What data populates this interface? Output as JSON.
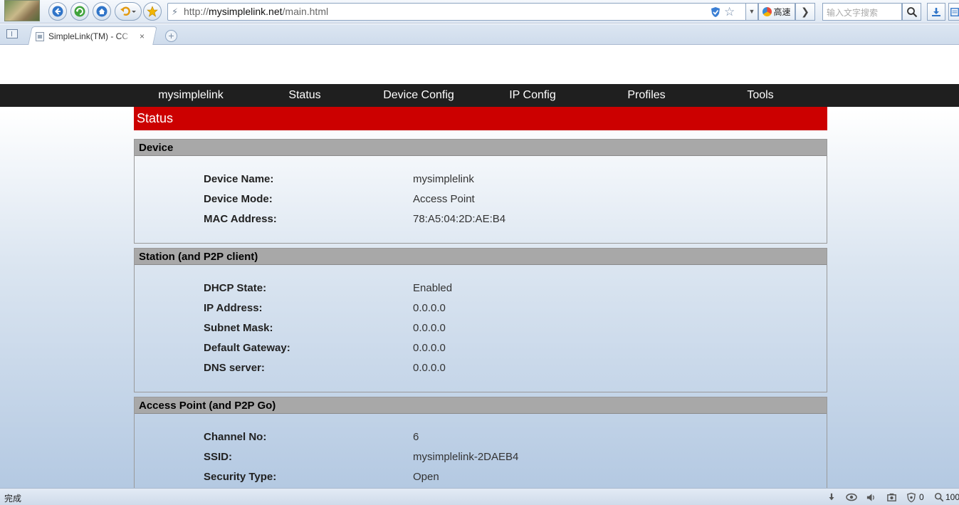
{
  "browser": {
    "url_prefix": "http://",
    "url_domain": "mysimplelink.net",
    "url_path": "/main.html",
    "speed_mode_label": "高速",
    "search_placeholder": "输入文字搜索",
    "tab_title": "SimpleLink(TM) - CC",
    "tab_close": "×",
    "new_tab": "+",
    "status_text": "完成",
    "status_count": "0",
    "zoom": "100"
  },
  "nav": {
    "items": [
      "mysimplelink",
      "Status",
      "Device Config",
      "IP Config",
      "Profiles",
      "Tools"
    ]
  },
  "page": {
    "banner_title": "Status"
  },
  "sections": [
    {
      "title": "Device",
      "rows": [
        {
          "label": "Device Name:",
          "value": "mysimplelink"
        },
        {
          "label": "Device Mode:",
          "value": "Access Point"
        },
        {
          "label": "MAC Address:",
          "value": "78:A5:04:2D:AE:B4"
        }
      ]
    },
    {
      "title": "Station (and P2P client)",
      "rows": [
        {
          "label": "DHCP State:",
          "value": "Enabled"
        },
        {
          "label": "IP Address:",
          "value": "0.0.0.0"
        },
        {
          "label": "Subnet Mask:",
          "value": "0.0.0.0"
        },
        {
          "label": "Default Gateway:",
          "value": "0.0.0.0"
        },
        {
          "label": "DNS server:",
          "value": "0.0.0.0"
        }
      ]
    },
    {
      "title": "Access Point (and P2P Go)",
      "rows": [
        {
          "label": "Channel No:",
          "value": "6"
        },
        {
          "label": "SSID:",
          "value": "mysimplelink-2DAEB4"
        },
        {
          "label": "Security Type:",
          "value": "Open"
        }
      ]
    }
  ],
  "colors": {
    "banner": "#cc0000",
    "navbar": "#1f1f1f",
    "section_header": "#a8a8a8"
  }
}
